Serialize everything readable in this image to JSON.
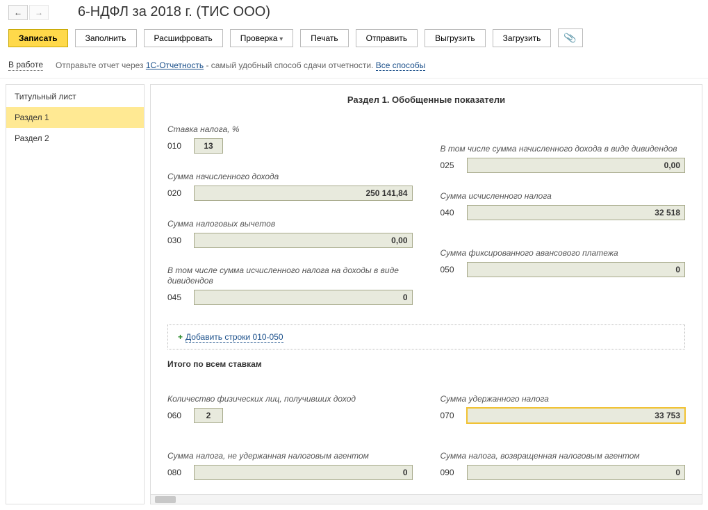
{
  "nav": {
    "back": "←",
    "forward": "→"
  },
  "title": "6-НДФЛ за 2018 г. (ТИС ООО)",
  "toolbar": {
    "write": "Записать",
    "fill": "Заполнить",
    "decode": "Расшифровать",
    "check": "Проверка",
    "print": "Печать",
    "send": "Отправить",
    "export": "Выгрузить",
    "load": "Загрузить"
  },
  "info": {
    "status": "В работе",
    "hint_pre": "Отправьте отчет через ",
    "hint_link": "1С-Отчетность",
    "hint_post": " - самый удобный способ сдачи отчетности. ",
    "all": "Все способы"
  },
  "sidebar": {
    "items": [
      {
        "label": "Титульный лист"
      },
      {
        "label": "Раздел 1"
      },
      {
        "label": "Раздел 2"
      }
    ]
  },
  "section": {
    "title": "Раздел 1. Обобщенные показатели",
    "left": {
      "rate_label": "Ставка налога, %",
      "row010": {
        "code": "010",
        "value": "13"
      },
      "income_label": "Сумма начисленного дохода",
      "row020": {
        "code": "020",
        "value": "250 141,84"
      },
      "deduct_label": "Сумма налоговых вычетов",
      "row030": {
        "code": "030",
        "value": "0,00"
      },
      "div_label": "В том числе сумма исчисленного налога на доходы в виде дивидендов",
      "row045": {
        "code": "045",
        "value": "0"
      }
    },
    "right": {
      "div_income_label": "В том числе сумма начисленного дохода в виде дивидендов",
      "row025": {
        "code": "025",
        "value": "0,00"
      },
      "calc_label": "Сумма исчисленного налога",
      "row040": {
        "code": "040",
        "value": "32 518"
      },
      "fixed_label": "Сумма фиксированного авансового платежа",
      "row050": {
        "code": "050",
        "value": "0"
      }
    },
    "add_lines": "Добавить строки 010-050",
    "totals_head": "Итого по всем ставкам",
    "bottom_left": {
      "count_label": "Количество физических лиц, получивших доход",
      "row060": {
        "code": "060",
        "value": "2"
      },
      "notheld_label": "Сумма налога, не удержанная налоговым агентом",
      "row080": {
        "code": "080",
        "value": "0"
      }
    },
    "bottom_right": {
      "held_label": "Сумма удержанного налога",
      "row070": {
        "code": "070",
        "value": "33 753"
      },
      "returned_label": "Сумма налога, возвращенная налоговым агентом",
      "row090": {
        "code": "090",
        "value": "0"
      }
    }
  }
}
